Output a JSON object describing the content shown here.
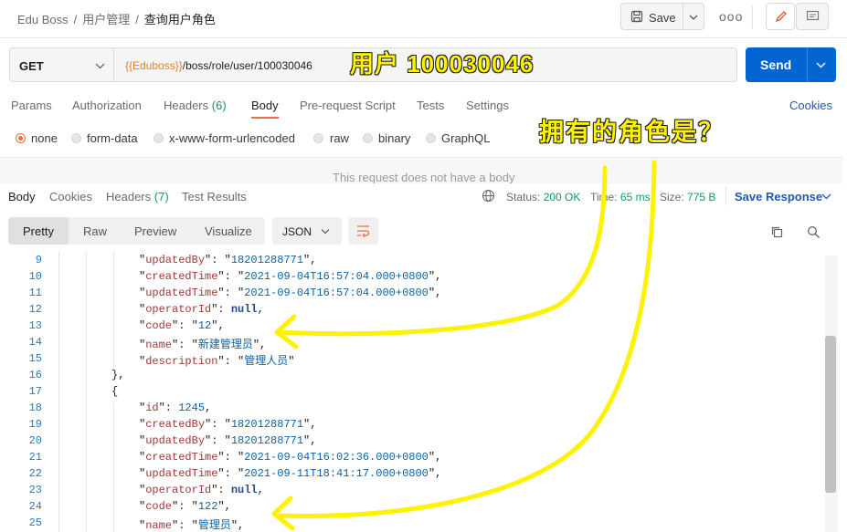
{
  "breadcrumb": [
    "Edu Boss",
    "用户管理",
    "查询用户角色"
  ],
  "breadcrumb_sep": "/",
  "header": {
    "save_label": "Save",
    "more_label": "ooo"
  },
  "request": {
    "method": "GET",
    "url_var": "{{Eduboss}}",
    "url_path": "/boss/role/user/100030046",
    "send_label": "Send"
  },
  "req_tabs": [
    {
      "label": "Params"
    },
    {
      "label": "Authorization"
    },
    {
      "label": "Headers",
      "count": "(6)"
    },
    {
      "label": "Body"
    },
    {
      "label": "Pre-request Script"
    },
    {
      "label": "Tests"
    },
    {
      "label": "Settings"
    }
  ],
  "cookies_label": "Cookies",
  "body_types": [
    "none",
    "form-data",
    "x-www-form-urlencoded",
    "raw",
    "binary",
    "GraphQL"
  ],
  "no_body_text": "This request does not have a body",
  "resp_tabs": [
    {
      "label": "Body"
    },
    {
      "label": "Cookies"
    },
    {
      "label": "Headers",
      "count": "(7)"
    },
    {
      "label": "Test Results"
    }
  ],
  "resp_status": {
    "status_label": "Status:",
    "status_value": "200 OK",
    "time_label": "Time:",
    "time_value": "65 ms",
    "size_label": "Size:",
    "size_value": "775 B"
  },
  "save_response_label": "Save Response",
  "view_modes": [
    "Pretty",
    "Raw",
    "Preview",
    "Visualize"
  ],
  "format_label": "JSON",
  "code_lines": [
    {
      "n": "9",
      "key": "updatedBy",
      "val": "18201288771",
      "type": "string",
      "level": 2,
      "comma": true
    },
    {
      "n": "10",
      "key": "createdTime",
      "val": "2021-09-04T16:57:04.000+0800",
      "type": "string",
      "level": 2,
      "comma": true
    },
    {
      "n": "11",
      "key": "updatedTime",
      "val": "2021-09-04T16:57:04.000+0800",
      "type": "string",
      "level": 2,
      "comma": true
    },
    {
      "n": "12",
      "key": "operatorId",
      "val": "null",
      "type": "null",
      "level": 2,
      "comma": true
    },
    {
      "n": "13",
      "key": "code",
      "val": "12",
      "type": "string",
      "level": 2,
      "comma": true
    },
    {
      "n": "14",
      "key": "name",
      "val": "新建管理员",
      "type": "string",
      "level": 2,
      "comma": true
    },
    {
      "n": "15",
      "key": "description",
      "val": "管理人员",
      "type": "string",
      "level": 2,
      "comma": false
    },
    {
      "n": "16",
      "raw": "},",
      "level": 1
    },
    {
      "n": "17",
      "raw": "{",
      "level": 1
    },
    {
      "n": "18",
      "key": "id",
      "val": "1245",
      "type": "number",
      "level": 2,
      "comma": true
    },
    {
      "n": "19",
      "key": "createdBy",
      "val": "18201288771",
      "type": "string",
      "level": 2,
      "comma": true
    },
    {
      "n": "20",
      "key": "updatedBy",
      "val": "18201288771",
      "type": "string",
      "level": 2,
      "comma": true
    },
    {
      "n": "21",
      "key": "createdTime",
      "val": "2021-09-04T16:02:36.000+0800",
      "type": "string",
      "level": 2,
      "comma": true
    },
    {
      "n": "22",
      "key": "updatedTime",
      "val": "2021-09-11T18:41:17.000+0800",
      "type": "string",
      "level": 2,
      "comma": true
    },
    {
      "n": "23",
      "key": "operatorId",
      "val": "null",
      "type": "null",
      "level": 2,
      "comma": true
    },
    {
      "n": "24",
      "key": "code",
      "val": "122",
      "type": "string",
      "level": 2,
      "comma": true
    },
    {
      "n": "25",
      "key": "name",
      "val": "管理员",
      "type": "string",
      "level": 2,
      "comma": true
    }
  ],
  "annotations": {
    "user_text": "用户 100030046",
    "question_text": "拥有的角色是？",
    "color": "#fff200"
  },
  "colors": {
    "accent": "#f26b3a",
    "send": "#0265d2",
    "link": "#1f57b5",
    "ok": "#0f9d58",
    "var": "#d9822b"
  }
}
